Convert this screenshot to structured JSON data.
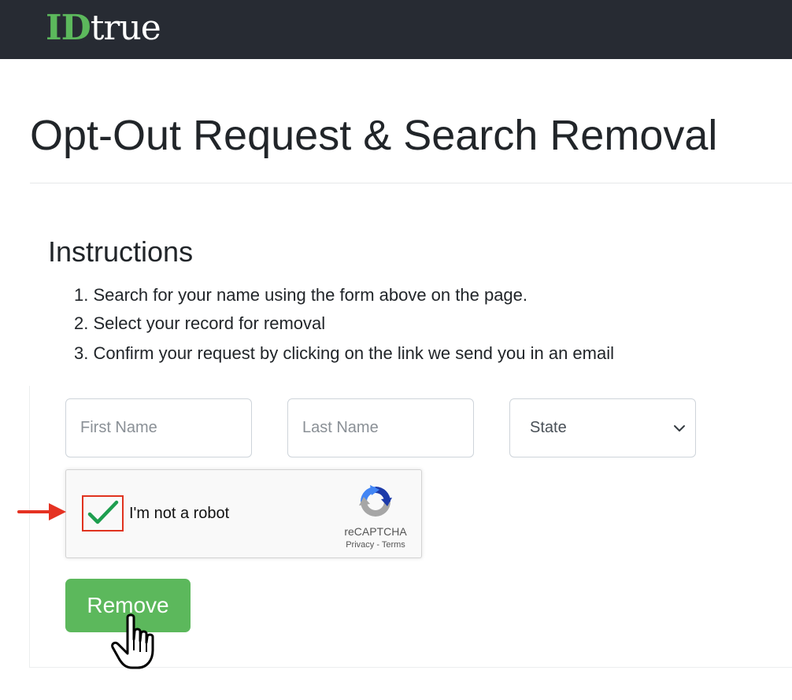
{
  "header": {
    "logo_id": "ID",
    "logo_true": "true",
    "logo_colors": {
      "id": "#5cb85c",
      "true": "#ffffff"
    },
    "background": "#272b33"
  },
  "page": {
    "title": "Opt-Out Request & Search Removal"
  },
  "instructions": {
    "title": "Instructions",
    "steps": [
      "1. Search for your name using the form above on the page.",
      "2. Select your record for removal",
      "3. Confirm your request by clicking on the link we send you in an email"
    ]
  },
  "form": {
    "first_name": {
      "placeholder": "First Name",
      "value": ""
    },
    "last_name": {
      "placeholder": "Last Name",
      "value": ""
    },
    "state": {
      "selected": "State",
      "icon": "chevron-down-icon"
    },
    "captcha": {
      "checked": true,
      "label": "I'm not a robot",
      "brand": "reCAPTCHA",
      "privacy": "Privacy",
      "separator": " - ",
      "terms": "Terms"
    },
    "remove_button": {
      "label": "Remove",
      "color": "#5cb85c"
    }
  },
  "annotations": {
    "arrow_color": "#e53222",
    "highlight_color": "#e0331f",
    "pointer": "hand-pointer-icon"
  }
}
